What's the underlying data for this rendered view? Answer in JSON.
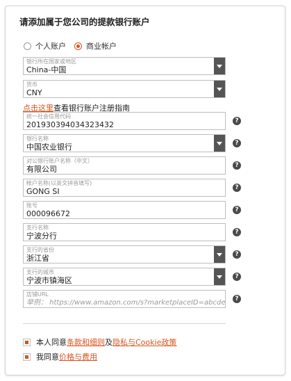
{
  "form": {
    "title": "请添加属于您公司的提款银行账户",
    "account_type": {
      "options": [
        "个人账户",
        "商业帐户"
      ],
      "selected": "商业帐户"
    },
    "fields": {
      "country": {
        "label": "银行所在国家或地区",
        "value": "China-中国"
      },
      "currency": {
        "label": "货币",
        "value": "CNY"
      },
      "credit_code": {
        "label": "统一社会信用代码",
        "value": "201930394034323432"
      },
      "bank_name": {
        "label": "银行名称",
        "value": "中国农业银行"
      },
      "company_account_name": {
        "label": "对公银行账户名称（中文）",
        "value": "有限公司"
      },
      "account_name_pinyin": {
        "label": "帐户名称(以英文拼音填写)",
        "value": "GONG SI"
      },
      "account_number": {
        "label": "账号",
        "value": "000096672"
      },
      "branch_name": {
        "label": "支行名称",
        "value": "宁波分行"
      },
      "branch_province": {
        "label": "支行的省份",
        "value": "浙江省"
      },
      "branch_city": {
        "label": "支行的城市",
        "value": "宁波市镇海区"
      },
      "store_url": {
        "label": "店铺URL",
        "placeholder": "举例：  https://www.amazon.com/s?marketplaceID=abcdefg"
      }
    },
    "help_icon": "?",
    "guide": {
      "link": "点击这里",
      "text": "查看银行账户注册指南"
    },
    "agreements": [
      {
        "prefix": "本人同意",
        "link1": "条款和细则",
        "mid": "及",
        "link2": "隐私与Cookie政策"
      },
      {
        "prefix": "我同意",
        "link1": "价格与费用"
      }
    ]
  },
  "colors": {
    "accent": "#d9531e",
    "dropdown": "#555555",
    "help_icon": "#4a4a4a"
  }
}
